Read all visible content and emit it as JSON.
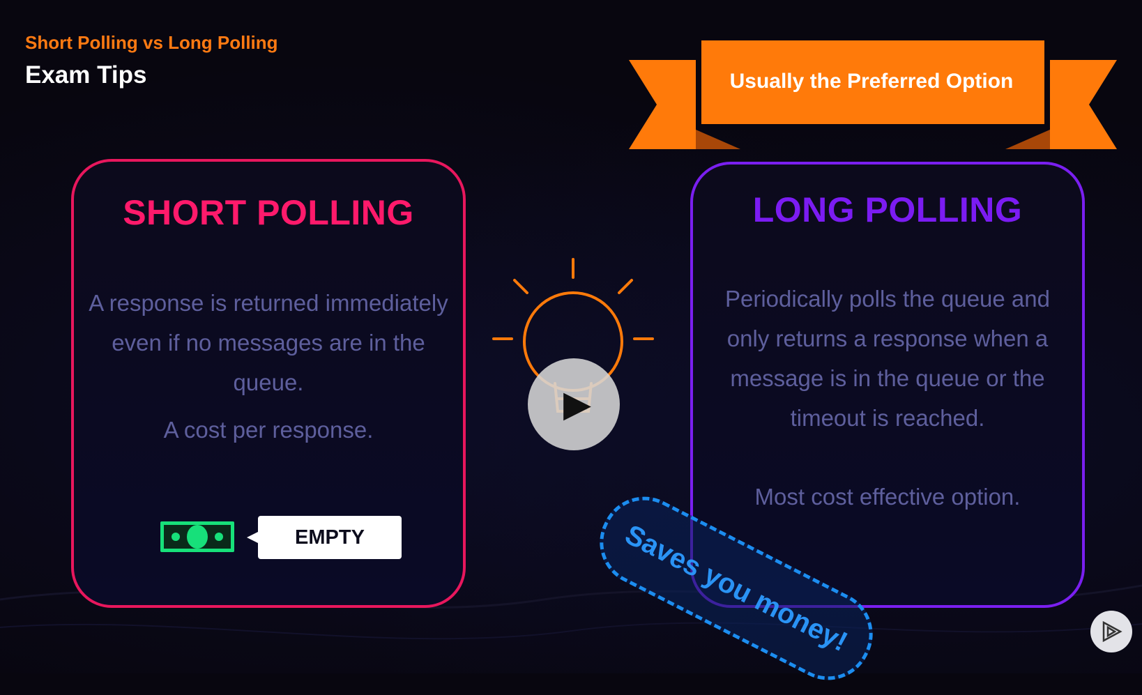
{
  "header": {
    "subtitle": "Short Polling vs Long Polling",
    "title": "Exam Tips"
  },
  "short_polling": {
    "heading": "SHORT POLLING",
    "description": "A response is returned immediately even if no messages are in the queue.",
    "note": "A cost per response.",
    "tag": "EMPTY",
    "icons": [
      "money-bill-icon"
    ]
  },
  "long_polling": {
    "heading": "LONG POLLING",
    "description": "Periodically polls the queue and only returns a response when a message is in the queue or the timeout is reached.",
    "note": "Most cost effective option.",
    "banner": "Usually the Preferred Option"
  },
  "stamp": {
    "text": "Saves you money!"
  },
  "icons": {
    "center": "lightbulb-icon",
    "player": "play-icon",
    "brand": "pluralsight-logo-icon"
  },
  "colors": {
    "short_accent": "#ff1a6b",
    "long_accent": "#7b1cf2",
    "ribbon": "#ff7a0a",
    "title_accent": "#ff7a12",
    "body_text": "#5e5f9d",
    "stamp": "#1c8df0",
    "money": "#17e07a"
  }
}
